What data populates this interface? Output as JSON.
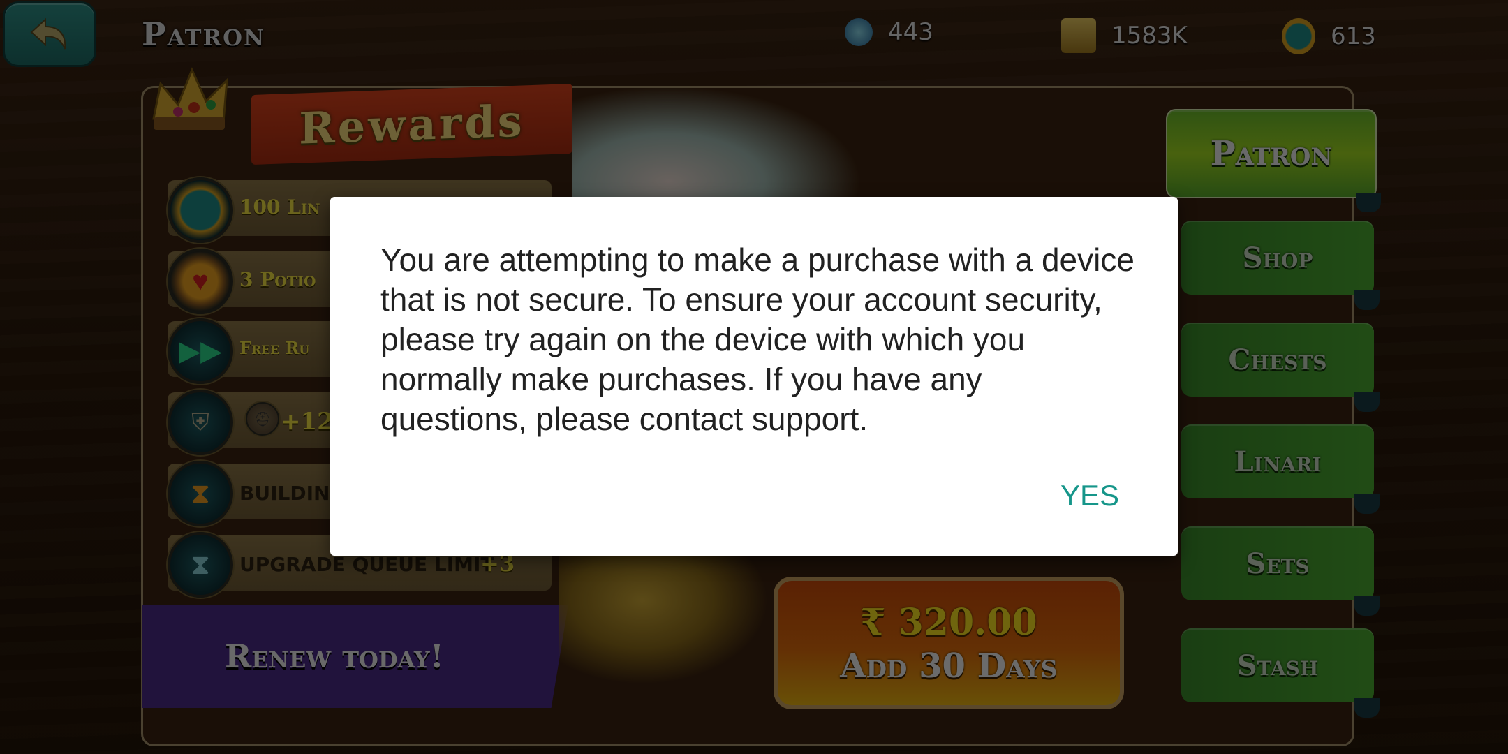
{
  "header": {
    "back_label": "Back",
    "title": "Patron",
    "currencies": [
      {
        "name": "gems",
        "icon": "skull-gem-icon",
        "value": "443"
      },
      {
        "name": "gold",
        "icon": "gold-coins-icon",
        "value": "1583K"
      },
      {
        "name": "linari",
        "icon": "linari-coin-icon",
        "value": "613"
      }
    ]
  },
  "rewards": {
    "title": "Rewards",
    "items": [
      {
        "icon": "linari-coin-icon",
        "label": "100 Lin"
      },
      {
        "icon": "potion-icon",
        "label": "3 Potio"
      },
      {
        "icon": "fast-forward-icon",
        "label": "Free Ru"
      },
      {
        "icon": "troops-icon",
        "label": "+12"
      },
      {
        "icon": "hourglass-gold-icon",
        "label": "BUILDIN"
      },
      {
        "icon": "hourglass-teal-icon",
        "label": "UPGRADE QUEUE LIMIT",
        "bonus": "+3"
      }
    ]
  },
  "renew_label": "Renew today!",
  "purchase": {
    "price": "₹ 320.00",
    "action": "Add 30 Days"
  },
  "side_tabs": [
    {
      "label": "Patron",
      "active": true
    },
    {
      "label": "Shop",
      "active": false
    },
    {
      "label": "Chests",
      "active": false
    },
    {
      "label": "Linari",
      "active": false
    },
    {
      "label": "Sets",
      "active": false
    },
    {
      "label": "Stash",
      "active": false
    }
  ],
  "dialog": {
    "message": "You are attempting to make a purchase with a device that is not secure. To ensure your account security, please try again on the device with which you normally make purchases. If you have any questions, please contact support.",
    "confirm_label": "YES",
    "accent_color": "#16968a"
  }
}
